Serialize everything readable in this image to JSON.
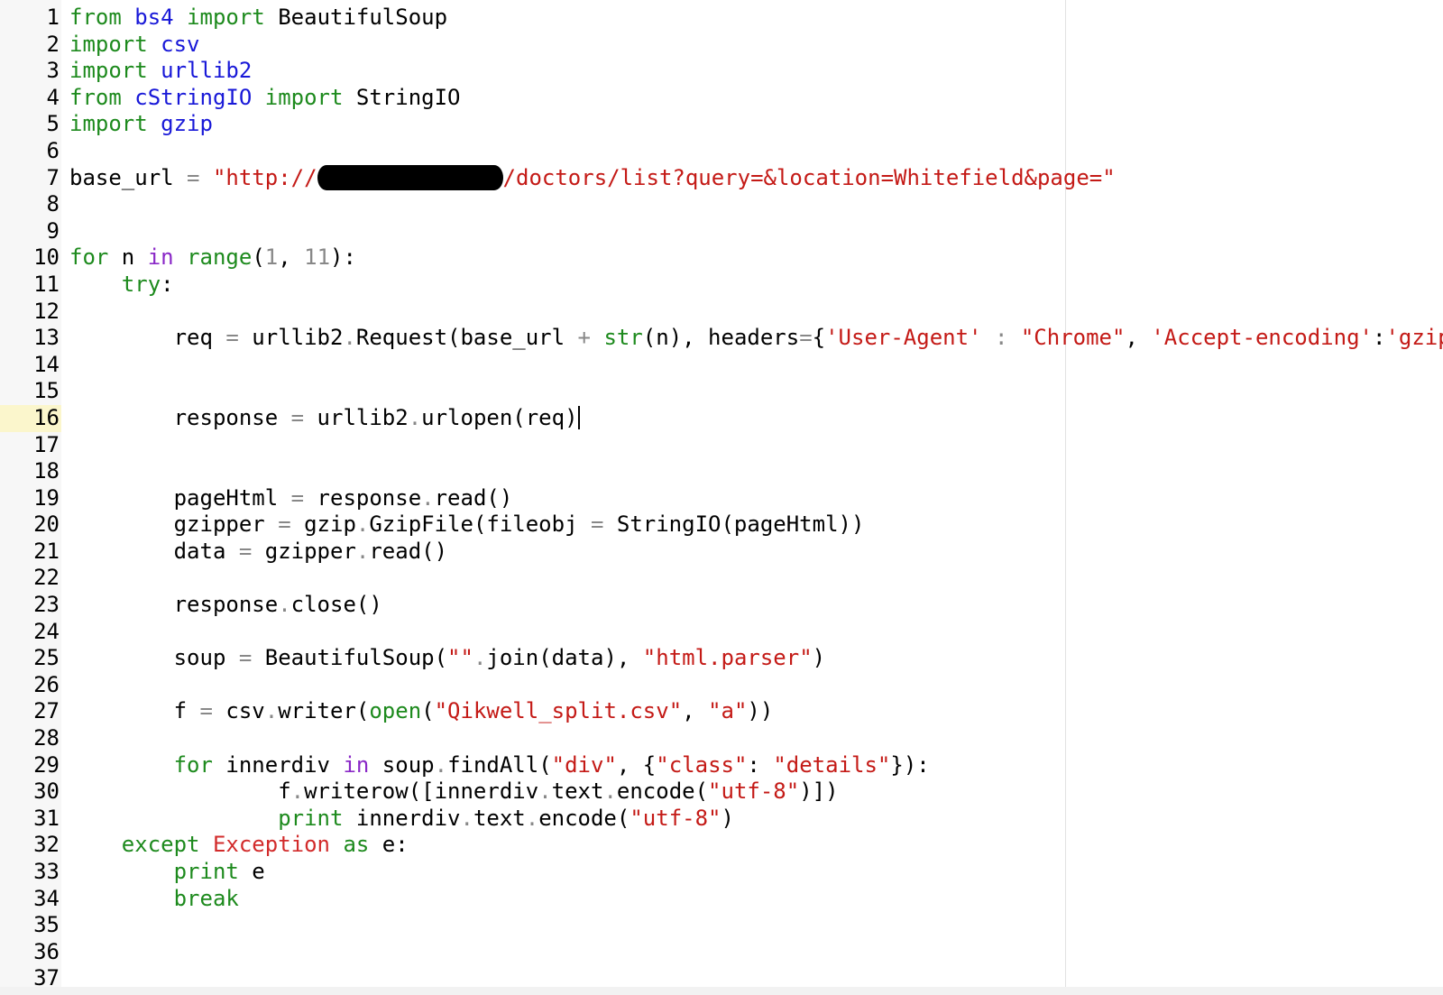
{
  "editor": {
    "current_line": 16,
    "lines": [
      {
        "n": "1",
        "tokens": [
          [
            "k",
            "from"
          ],
          [
            "",
            " "
          ],
          [
            "m",
            "bs4"
          ],
          [
            "",
            " "
          ],
          [
            "k",
            "import"
          ],
          [
            "",
            " BeautifulSoup"
          ]
        ]
      },
      {
        "n": "2",
        "tokens": [
          [
            "k",
            "import"
          ],
          [
            "",
            " "
          ],
          [
            "m",
            "csv"
          ]
        ]
      },
      {
        "n": "3",
        "tokens": [
          [
            "k",
            "import"
          ],
          [
            "",
            " "
          ],
          [
            "m",
            "urllib2"
          ]
        ]
      },
      {
        "n": "4",
        "tokens": [
          [
            "k",
            "from"
          ],
          [
            "",
            " "
          ],
          [
            "m",
            "cStringIO"
          ],
          [
            "",
            " "
          ],
          [
            "k",
            "import"
          ],
          [
            "",
            " StringIO"
          ]
        ]
      },
      {
        "n": "5",
        "tokens": [
          [
            "k",
            "import"
          ],
          [
            "",
            " "
          ],
          [
            "m",
            "gzip"
          ]
        ]
      },
      {
        "n": "6",
        "tokens": []
      },
      {
        "n": "7",
        "tokens": [
          [
            "",
            "base_url "
          ],
          [
            "o",
            "="
          ],
          [
            "",
            " "
          ],
          [
            "s",
            "\"http://"
          ],
          [
            "redact",
            ""
          ],
          [
            "s",
            "/doctors/list?query=&location=Whitefield&page=\""
          ]
        ]
      },
      {
        "n": "8",
        "tokens": []
      },
      {
        "n": "9",
        "tokens": []
      },
      {
        "n": "10",
        "tokens": [
          [
            "k",
            "for"
          ],
          [
            "",
            " n "
          ],
          [
            "c",
            "in"
          ],
          [
            "",
            " "
          ],
          [
            "k",
            "range"
          ],
          [
            "",
            "("
          ],
          [
            "o",
            "1"
          ],
          [
            "",
            ", "
          ],
          [
            "o",
            "11"
          ],
          [
            "",
            "):"
          ]
        ]
      },
      {
        "n": "11",
        "tokens": [
          [
            "",
            "    "
          ],
          [
            "k",
            "try"
          ],
          [
            "",
            ":"
          ]
        ]
      },
      {
        "n": "12",
        "tokens": []
      },
      {
        "n": "13",
        "tokens": [
          [
            "",
            "        req "
          ],
          [
            "o",
            "="
          ],
          [
            "",
            " urllib2"
          ],
          [
            "o",
            "."
          ],
          [
            "",
            "Request(base_url "
          ],
          [
            "o",
            "+"
          ],
          [
            "",
            " "
          ],
          [
            "k",
            "str"
          ],
          [
            "",
            "(n), headers"
          ],
          [
            "o",
            "="
          ],
          [
            "",
            "{"
          ],
          [
            "s",
            "'User-Agent'"
          ],
          [
            "",
            " "
          ],
          [
            "o",
            ":"
          ],
          [
            "",
            " "
          ],
          [
            "s",
            "\"Chrome\""
          ],
          [
            "",
            ", "
          ],
          [
            "s",
            "'Accept-encoding'"
          ],
          [
            "",
            ":"
          ],
          [
            "s",
            "'gzip'"
          ],
          [
            "",
            "})"
          ]
        ]
      },
      {
        "n": "14",
        "tokens": []
      },
      {
        "n": "15",
        "tokens": []
      },
      {
        "n": "16",
        "tokens": [
          [
            "",
            "        response "
          ],
          [
            "o",
            "="
          ],
          [
            "",
            " urllib2"
          ],
          [
            "o",
            "."
          ],
          [
            "",
            "urlopen(req)"
          ],
          [
            "cursor",
            ""
          ]
        ]
      },
      {
        "n": "17",
        "tokens": []
      },
      {
        "n": "18",
        "tokens": []
      },
      {
        "n": "19",
        "tokens": [
          [
            "",
            "        pageHtml "
          ],
          [
            "o",
            "="
          ],
          [
            "",
            " response"
          ],
          [
            "o",
            "."
          ],
          [
            "",
            "read()"
          ]
        ]
      },
      {
        "n": "20",
        "tokens": [
          [
            "",
            "        gzipper "
          ],
          [
            "o",
            "="
          ],
          [
            "",
            " gzip"
          ],
          [
            "o",
            "."
          ],
          [
            "",
            "GzipFile(fileobj "
          ],
          [
            "o",
            "="
          ],
          [
            "",
            " StringIO(pageHtml))"
          ]
        ]
      },
      {
        "n": "21",
        "tokens": [
          [
            "",
            "        data "
          ],
          [
            "o",
            "="
          ],
          [
            "",
            " gzipper"
          ],
          [
            "o",
            "."
          ],
          [
            "",
            "read()"
          ]
        ]
      },
      {
        "n": "22",
        "tokens": []
      },
      {
        "n": "23",
        "tokens": [
          [
            "",
            "        response"
          ],
          [
            "o",
            "."
          ],
          [
            "",
            "close()"
          ]
        ]
      },
      {
        "n": "24",
        "tokens": []
      },
      {
        "n": "25",
        "tokens": [
          [
            "",
            "        soup "
          ],
          [
            "o",
            "="
          ],
          [
            "",
            " BeautifulSoup("
          ],
          [
            "s",
            "\"\""
          ],
          [
            "o",
            "."
          ],
          [
            "",
            "join(data), "
          ],
          [
            "s",
            "\"html.parser\""
          ],
          [
            "",
            ")"
          ]
        ]
      },
      {
        "n": "26",
        "tokens": []
      },
      {
        "n": "27",
        "tokens": [
          [
            "",
            "        f "
          ],
          [
            "o",
            "="
          ],
          [
            "",
            " csv"
          ],
          [
            "o",
            "."
          ],
          [
            "",
            "writer("
          ],
          [
            "k",
            "open"
          ],
          [
            "",
            "("
          ],
          [
            "s",
            "\"Qikwell_split.csv\""
          ],
          [
            "",
            ", "
          ],
          [
            "s",
            "\"a\""
          ],
          [
            "",
            "))"
          ]
        ]
      },
      {
        "n": "28",
        "tokens": []
      },
      {
        "n": "29",
        "tokens": [
          [
            "",
            "        "
          ],
          [
            "k",
            "for"
          ],
          [
            "",
            " innerdiv "
          ],
          [
            "c",
            "in"
          ],
          [
            "",
            " soup"
          ],
          [
            "o",
            "."
          ],
          [
            "",
            "findAll("
          ],
          [
            "s",
            "\"div\""
          ],
          [
            "",
            ", {"
          ],
          [
            "s",
            "\"class\""
          ],
          [
            "",
            ": "
          ],
          [
            "s",
            "\"details\""
          ],
          [
            "",
            "}):"
          ]
        ]
      },
      {
        "n": "30",
        "tokens": [
          [
            "",
            "                f"
          ],
          [
            "o",
            "."
          ],
          [
            "",
            "writerow([innerdiv"
          ],
          [
            "o",
            "."
          ],
          [
            "",
            "text"
          ],
          [
            "o",
            "."
          ],
          [
            "",
            "encode("
          ],
          [
            "s",
            "\"utf-8\""
          ],
          [
            "",
            ")])"
          ]
        ]
      },
      {
        "n": "31",
        "tokens": [
          [
            "",
            "                "
          ],
          [
            "k",
            "print"
          ],
          [
            "",
            " innerdiv"
          ],
          [
            "o",
            "."
          ],
          [
            "",
            "text"
          ],
          [
            "o",
            "."
          ],
          [
            "",
            "encode("
          ],
          [
            "s",
            "\"utf-8\""
          ],
          [
            "",
            ")"
          ]
        ]
      },
      {
        "n": "32",
        "tokens": [
          [
            "",
            "    "
          ],
          [
            "k",
            "except"
          ],
          [
            "",
            " "
          ],
          [
            "e",
            "Exception"
          ],
          [
            "",
            " "
          ],
          [
            "k",
            "as"
          ],
          [
            "",
            " e:"
          ]
        ]
      },
      {
        "n": "33",
        "tokens": [
          [
            "",
            "        "
          ],
          [
            "k",
            "print"
          ],
          [
            "",
            " e"
          ]
        ]
      },
      {
        "n": "34",
        "tokens": [
          [
            "",
            "        "
          ],
          [
            "k",
            "break"
          ]
        ]
      },
      {
        "n": "35",
        "tokens": []
      },
      {
        "n": "36",
        "tokens": []
      },
      {
        "n": "37",
        "tokens": []
      }
    ]
  }
}
